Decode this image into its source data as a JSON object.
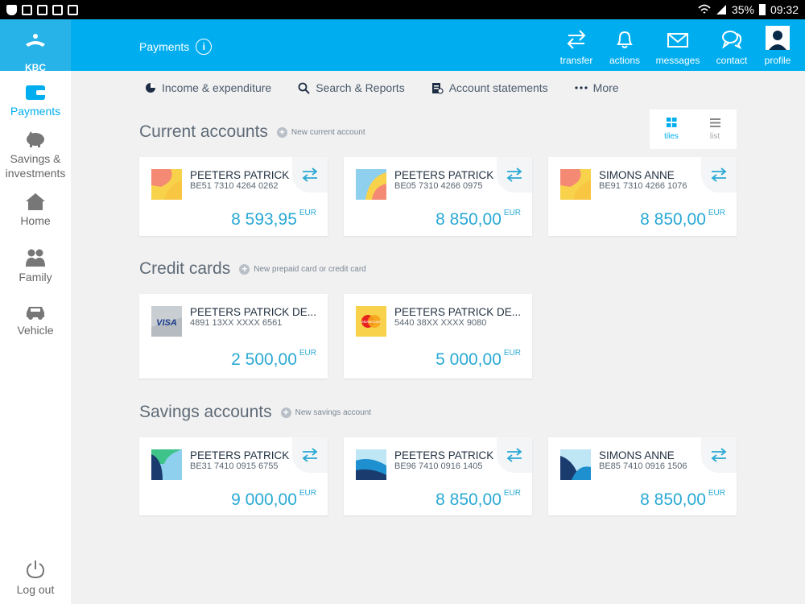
{
  "statusbar": {
    "battery": "35%",
    "time": "09:32"
  },
  "brand": {
    "logo_text": "KBC"
  },
  "header": {
    "title": "Payments",
    "actions": [
      {
        "label": "transfer",
        "icon": "transfer-icon"
      },
      {
        "label": "actions",
        "icon": "bell-icon"
      },
      {
        "label": "messages",
        "icon": "envelope-icon"
      },
      {
        "label": "contact",
        "icon": "chat-icon"
      },
      {
        "label": "profile",
        "icon": "profile-avatar-icon"
      }
    ]
  },
  "sidebar": {
    "items": [
      {
        "label": "Payments",
        "icon": "wallet-icon"
      },
      {
        "label": "Savings & investments",
        "icon": "piggy-bank-icon"
      },
      {
        "label": "Home",
        "icon": "house-icon"
      },
      {
        "label": "Family",
        "icon": "family-icon"
      },
      {
        "label": "Vehicle",
        "icon": "car-icon"
      }
    ],
    "logout": "Log out"
  },
  "subnav": {
    "items": [
      {
        "label": "Income & expenditure",
        "icon": "pie-chart-icon"
      },
      {
        "label": "Search & Reports",
        "icon": "search-icon"
      },
      {
        "label": "Account statements",
        "icon": "statement-icon"
      },
      {
        "label": "More",
        "icon": "more-dots-icon"
      }
    ]
  },
  "view_toggle": {
    "tiles": "tiles",
    "list": "list",
    "selected": "tiles"
  },
  "sections": {
    "current": {
      "title": "Current accounts",
      "add": "New current account",
      "accounts": [
        {
          "name": "PEETERS PATRICK",
          "number": "BE51 7310 4264 0262",
          "amount": "8 593,95",
          "currency": "EUR"
        },
        {
          "name": "PEETERS PATRICK",
          "number": "BE05 7310 4266 0975",
          "amount": "8 850,00",
          "currency": "EUR"
        },
        {
          "name": "SIMONS ANNE",
          "number": "BE91 7310 4266 1076",
          "amount": "8 850,00",
          "currency": "EUR"
        }
      ]
    },
    "credit": {
      "title": "Credit cards",
      "add": "New prepaid card or credit card",
      "cards": [
        {
          "name": "PEETERS PATRICK DE...",
          "number": "4891 13XX XXXX 6561",
          "amount": "2 500,00",
          "currency": "EUR",
          "brand": "VISA"
        },
        {
          "name": "PEETERS PATRICK DE...",
          "number": "5440 38XX XXXX 9080",
          "amount": "5 000,00",
          "currency": "EUR",
          "brand": "MasterCard"
        }
      ]
    },
    "savings": {
      "title": "Savings accounts",
      "add": "New savings account",
      "accounts": [
        {
          "name": "PEETERS PATRICK",
          "number": "BE31 7410 0915 6755",
          "amount": "9 000,00",
          "currency": "EUR"
        },
        {
          "name": "PEETERS PATRICK",
          "number": "BE96 7410 0916 1405",
          "amount": "8 850,00",
          "currency": "EUR"
        },
        {
          "name": "SIMONS ANNE",
          "number": "BE85 7410 0916 1506",
          "amount": "8 850,00",
          "currency": "EUR"
        }
      ]
    }
  },
  "colors": {
    "accent": "#00aeef",
    "amount": "#29a9d4"
  }
}
